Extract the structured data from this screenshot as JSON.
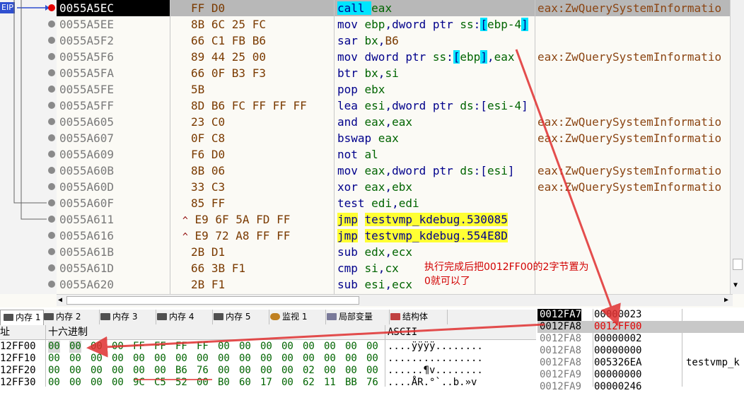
{
  "disasm": {
    "rows": [
      {
        "addr": "0055A5EC",
        "bytes": "FF D0",
        "jump": "",
        "asm": [
          {
            "t": "call ",
            "c": "m"
          },
          {
            "t": "eax",
            "c": "reg"
          }
        ],
        "comment": "eax:ZwQuerySystemInformatio",
        "highlight": true,
        "bp": "red"
      },
      {
        "addr": "0055A5EE",
        "bytes": "8B 6C 25 FC",
        "jump": "",
        "asm": [
          {
            "t": "mov ",
            "c": "m"
          },
          {
            "t": "ebp",
            "c": "reg"
          },
          {
            "t": ",dword ptr ",
            "c": "m"
          },
          {
            "t": "ss",
            "c": "reg"
          },
          {
            "t": ":",
            "c": "m"
          },
          {
            "t": "[",
            "c": "brk"
          },
          {
            "t": "ebp-4",
            "c": "reg"
          },
          {
            "t": "]",
            "c": "brk"
          }
        ],
        "comment": "",
        "bp": "grey"
      },
      {
        "addr": "0055A5F2",
        "bytes": "66 C1 FB B6",
        "jump": "",
        "asm": [
          {
            "t": "sar ",
            "c": "m"
          },
          {
            "t": "bx",
            "c": "reg"
          },
          {
            "t": ",",
            "c": "m"
          },
          {
            "t": "B6",
            "c": "imm"
          }
        ],
        "comment": "",
        "bp": "grey"
      },
      {
        "addr": "0055A5F6",
        "bytes": "89 44 25 00",
        "jump": "",
        "asm": [
          {
            "t": "mov dword ptr ",
            "c": "m"
          },
          {
            "t": "ss",
            "c": "reg"
          },
          {
            "t": ":",
            "c": "m"
          },
          {
            "t": "[",
            "c": "brk"
          },
          {
            "t": "ebp",
            "c": "reg"
          },
          {
            "t": "]",
            "c": "brk"
          },
          {
            "t": ",",
            "c": "m"
          },
          {
            "t": "eax",
            "c": "reg"
          }
        ],
        "comment": "eax:ZwQuerySystemInformatio",
        "bp": "grey"
      },
      {
        "addr": "0055A5FA",
        "bytes": "66 0F B3 F3",
        "jump": "",
        "asm": [
          {
            "t": "btr ",
            "c": "m"
          },
          {
            "t": "bx",
            "c": "reg"
          },
          {
            "t": ",",
            "c": "m"
          },
          {
            "t": "si",
            "c": "reg"
          }
        ],
        "comment": "",
        "bp": "grey"
      },
      {
        "addr": "0055A5FE",
        "bytes": "5B",
        "jump": "",
        "asm": [
          {
            "t": "pop ",
            "c": "m"
          },
          {
            "t": "ebx",
            "c": "reg"
          }
        ],
        "comment": "",
        "bp": "grey"
      },
      {
        "addr": "0055A5FF",
        "bytes": "8D B6 FC FF FF FF",
        "jump": "",
        "asm": [
          {
            "t": "lea ",
            "c": "m"
          },
          {
            "t": "esi",
            "c": "reg"
          },
          {
            "t": ",dword ptr ",
            "c": "m"
          },
          {
            "t": "ds",
            "c": "reg"
          },
          {
            "t": ":[",
            "c": "m"
          },
          {
            "t": "esi-4",
            "c": "reg"
          },
          {
            "t": "]",
            "c": "m"
          }
        ],
        "comment": "",
        "bp": "grey"
      },
      {
        "addr": "0055A605",
        "bytes": "23 C0",
        "jump": "",
        "asm": [
          {
            "t": "and ",
            "c": "m"
          },
          {
            "t": "eax",
            "c": "reg"
          },
          {
            "t": ",",
            "c": "m"
          },
          {
            "t": "eax",
            "c": "reg"
          }
        ],
        "comment": "eax:ZwQuerySystemInformatio",
        "bp": "grey"
      },
      {
        "addr": "0055A607",
        "bytes": "0F C8",
        "jump": "",
        "asm": [
          {
            "t": "bswap ",
            "c": "m"
          },
          {
            "t": "eax",
            "c": "reg"
          }
        ],
        "comment": "eax:ZwQuerySystemInformatio",
        "bp": "grey"
      },
      {
        "addr": "0055A609",
        "bytes": "F6 D0",
        "jump": "",
        "asm": [
          {
            "t": "not ",
            "c": "m"
          },
          {
            "t": "al",
            "c": "reg"
          }
        ],
        "comment": "",
        "bp": "grey"
      },
      {
        "addr": "0055A60B",
        "bytes": "8B 06",
        "jump": "",
        "asm": [
          {
            "t": "mov ",
            "c": "m"
          },
          {
            "t": "eax",
            "c": "reg"
          },
          {
            "t": ",dword ptr ",
            "c": "m"
          },
          {
            "t": "ds",
            "c": "reg"
          },
          {
            "t": ":[",
            "c": "m"
          },
          {
            "t": "esi",
            "c": "reg"
          },
          {
            "t": "]",
            "c": "m"
          }
        ],
        "comment": "eax:ZwQuerySystemInformatio",
        "bp": "grey"
      },
      {
        "addr": "0055A60D",
        "bytes": "33 C3",
        "jump": "",
        "asm": [
          {
            "t": "xor ",
            "c": "m"
          },
          {
            "t": "eax",
            "c": "reg"
          },
          {
            "t": ",",
            "c": "m"
          },
          {
            "t": "ebx",
            "c": "reg"
          }
        ],
        "comment": "eax:ZwQuerySystemInformatio",
        "bp": "grey"
      },
      {
        "addr": "0055A60F",
        "bytes": "85 FF",
        "jump": "",
        "asm": [
          {
            "t": "test ",
            "c": "m"
          },
          {
            "t": "edi",
            "c": "reg"
          },
          {
            "t": ",",
            "c": "m"
          },
          {
            "t": "edi",
            "c": "reg"
          }
        ],
        "comment": "",
        "bp": "grey"
      },
      {
        "addr": "0055A611",
        "bytes": "E9 6F 5A FD FF",
        "jump": "^",
        "asm": [
          {
            "t": "jmp",
            "c": "yel"
          },
          {
            "t": " ",
            "c": "m"
          },
          {
            "t": "testvmp_kdebug.530085",
            "c": "yel"
          }
        ],
        "comment": "",
        "bp": "grey"
      },
      {
        "addr": "0055A616",
        "bytes": "E9 72 A8 FF FF",
        "jump": "^",
        "asm": [
          {
            "t": "jmp",
            "c": "yel"
          },
          {
            "t": " ",
            "c": "m"
          },
          {
            "t": "testvmp_kdebug.554E8D",
            "c": "yel"
          }
        ],
        "comment": "",
        "bp": "grey"
      },
      {
        "addr": "0055A61B",
        "bytes": "2B D1",
        "jump": "",
        "asm": [
          {
            "t": "sub ",
            "c": "m"
          },
          {
            "t": "edx",
            "c": "reg"
          },
          {
            "t": ",",
            "c": "m"
          },
          {
            "t": "ecx",
            "c": "reg"
          }
        ],
        "comment": "",
        "bp": "grey"
      },
      {
        "addr": "0055A61D",
        "bytes": "66 3B F1",
        "jump": "",
        "asm": [
          {
            "t": "cmp ",
            "c": "m"
          },
          {
            "t": "si",
            "c": "reg"
          },
          {
            "t": ",",
            "c": "m"
          },
          {
            "t": "cx",
            "c": "reg"
          }
        ],
        "comment": "",
        "bp": "grey"
      },
      {
        "addr": "0055A620",
        "bytes": "2B F1",
        "jump": "",
        "asm": [
          {
            "t": "sub ",
            "c": "m"
          },
          {
            "t": "esi",
            "c": "reg"
          },
          {
            "t": ",",
            "c": "m"
          },
          {
            "t": "ecx",
            "c": "reg"
          }
        ],
        "comment": "",
        "bp": "grey"
      }
    ]
  },
  "gutter_marker": "EIP",
  "annotation": {
    "line1": "执行完成后把0012FF00的2字节置为",
    "line2": "0就可以了"
  },
  "tabs": [
    {
      "label": "内存 1",
      "icon": "memory-icon",
      "active": true
    },
    {
      "label": "内存 2",
      "icon": "memory-icon"
    },
    {
      "label": "内存 3",
      "icon": "memory-icon"
    },
    {
      "label": "内存 4",
      "icon": "memory-icon"
    },
    {
      "label": "内存 5",
      "icon": "memory-icon"
    },
    {
      "label": "监视 1",
      "icon": "watch-icon"
    },
    {
      "label": "局部变量",
      "icon": "locals-icon"
    },
    {
      "label": "结构体",
      "icon": "struct-icon"
    }
  ],
  "dump": {
    "headers": {
      "addr": "址",
      "hex": "十六进制",
      "ascii": "ASCII"
    },
    "rows": [
      {
        "addr": "12FF00",
        "hex": [
          "00",
          "00",
          "00",
          "00",
          "FF",
          "FF",
          "FF",
          "FF",
          "00",
          "00",
          "00",
          "00",
          "00",
          "00",
          "00",
          "00"
        ],
        "ascii": "....ÿÿÿÿ........"
      },
      {
        "addr": "12FF10",
        "hex": [
          "00",
          "00",
          "00",
          "00",
          "00",
          "00",
          "00",
          "00",
          "00",
          "00",
          "00",
          "00",
          "00",
          "00",
          "00",
          "00"
        ],
        "ascii": "................"
      },
      {
        "addr": "12FF20",
        "hex": [
          "00",
          "00",
          "00",
          "00",
          "00",
          "00",
          "B6",
          "76",
          "00",
          "00",
          "00",
          "00",
          "02",
          "00",
          "00",
          "00"
        ],
        "ascii": "......¶v........"
      },
      {
        "addr": "12FF30",
        "hex": [
          "00",
          "00",
          "00",
          "00",
          "9C",
          "C5",
          "52",
          "00",
          "B0",
          "60",
          "17",
          "00",
          "62",
          "11",
          "BB",
          "76"
        ],
        "ascii": "....ÅR.°`..b.»v"
      }
    ]
  },
  "stack": {
    "rows": [
      {
        "addr": "0012FA7",
        "val": "00000023",
        "cmt": "",
        "sel": true
      },
      {
        "addr": "0012FA8",
        "val": "0012FF00",
        "cmt": "",
        "hl": true
      },
      {
        "addr": "0012FA8",
        "val": "00000002",
        "cmt": ""
      },
      {
        "addr": "0012FA8",
        "val": "00000000",
        "cmt": ""
      },
      {
        "addr": "0012FA8",
        "val": "005326EA",
        "cmt": "testvmp_k"
      },
      {
        "addr": "0012FA9",
        "val": "00000000",
        "cmt": ""
      },
      {
        "addr": "0012FA9",
        "val": "00000246",
        "cmt": ""
      }
    ]
  },
  "colors": {
    "asm": "#00008b",
    "register": "#006400",
    "comment": "#8b4513",
    "annotation": "#d20000"
  }
}
